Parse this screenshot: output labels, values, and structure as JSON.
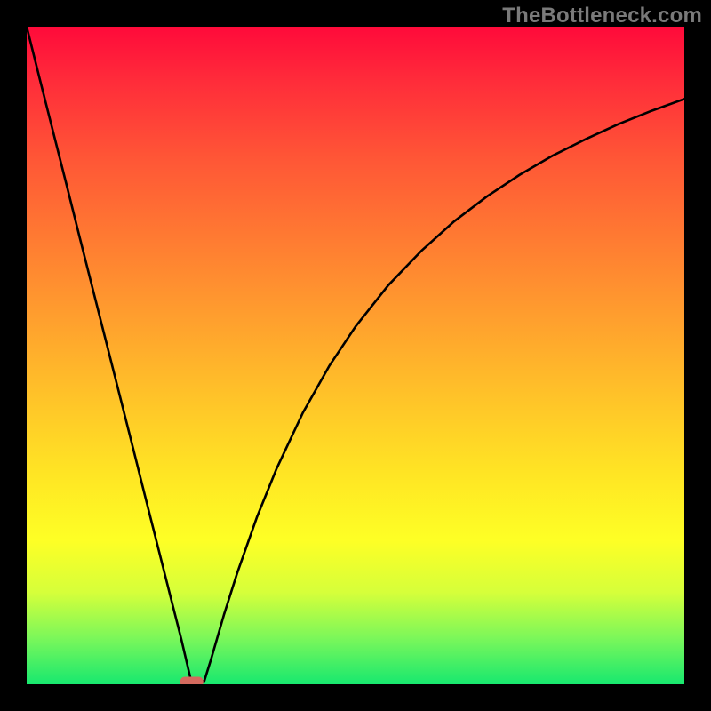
{
  "watermark": "TheBottleneck.com",
  "chart_data": {
    "type": "line",
    "title": "",
    "xlabel": "",
    "ylabel": "",
    "xlim": [
      0,
      100
    ],
    "ylim": [
      0,
      100
    ],
    "series": [
      {
        "name": "curve",
        "x": [
          0,
          2,
          4,
          6,
          8,
          10,
          12,
          14,
          16,
          18,
          20,
          22,
          23.5,
          25,
          26,
          27,
          28,
          30,
          32,
          35,
          38,
          42,
          46,
          50,
          55,
          60,
          65,
          70,
          75,
          80,
          85,
          90,
          95,
          100
        ],
        "y": [
          100,
          92,
          84.1,
          76.2,
          68.2,
          60.3,
          52.4,
          44.5,
          36.6,
          28.6,
          20.7,
          12.8,
          6.9,
          0.5,
          0.3,
          0.5,
          3.7,
          10.6,
          16.9,
          25.4,
          32.8,
          41.3,
          48.4,
          54.4,
          60.7,
          65.9,
          70.4,
          74.2,
          77.5,
          80.4,
          82.9,
          85.2,
          87.2,
          89.0
        ]
      }
    ],
    "marker": {
      "x": 25.1,
      "y": 0.4,
      "color": "#d46a5e"
    },
    "gradient_stops": [
      {
        "pos": 0,
        "color": "#ff0a3a"
      },
      {
        "pos": 20,
        "color": "#ff5636"
      },
      {
        "pos": 44,
        "color": "#ff9e2e"
      },
      {
        "pos": 68,
        "color": "#ffe524"
      },
      {
        "pos": 86,
        "color": "#d6ff3a"
      },
      {
        "pos": 100,
        "color": "#17e86f"
      }
    ]
  }
}
